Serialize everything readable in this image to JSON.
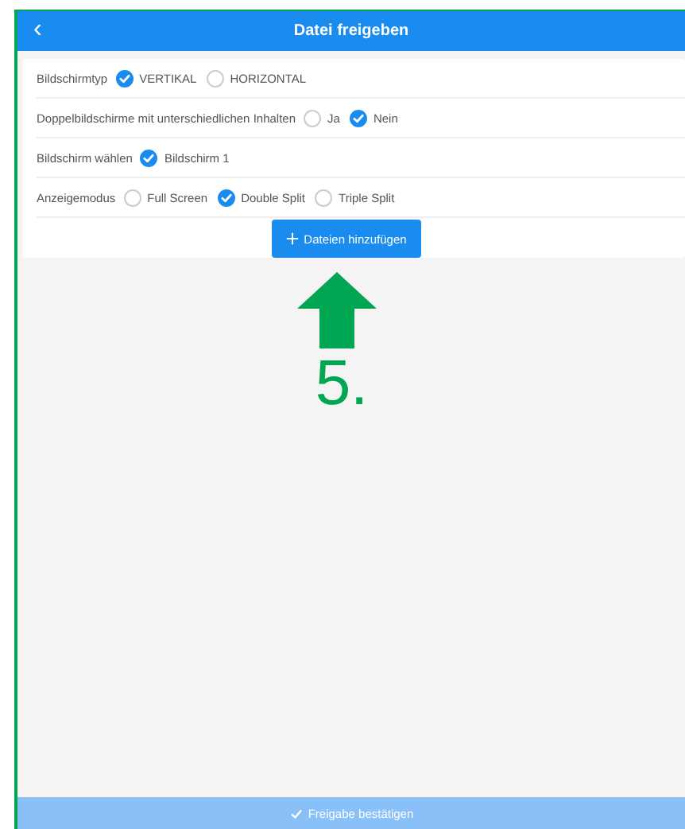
{
  "header": {
    "back": "‹",
    "title": "Datei freigeben"
  },
  "rows": [
    {
      "label": "Bildschirmtyp",
      "options": [
        {
          "label": "VERTIKAL",
          "selected": true
        },
        {
          "label": "HORIZONTAL",
          "selected": false
        }
      ]
    },
    {
      "label": "Doppelbildschirme mit unterschiedlichen Inhalten",
      "options": [
        {
          "label": "Ja",
          "selected": false
        },
        {
          "label": "Nein",
          "selected": true
        }
      ]
    },
    {
      "label": "Bildschirm wählen",
      "options": [
        {
          "label": "Bildschirm 1",
          "selected": true
        }
      ]
    },
    {
      "label": "Anzeigemodus",
      "options": [
        {
          "label": "Full Screen",
          "selected": false
        },
        {
          "label": "Double Split",
          "selected": true
        },
        {
          "label": "Triple Split",
          "selected": false
        }
      ]
    }
  ],
  "add_button": {
    "label": "Dateien hinzufügen"
  },
  "annotation": {
    "label": "5."
  },
  "footer_button": {
    "label": "Freigabe bestätigen",
    "disabled": true
  }
}
